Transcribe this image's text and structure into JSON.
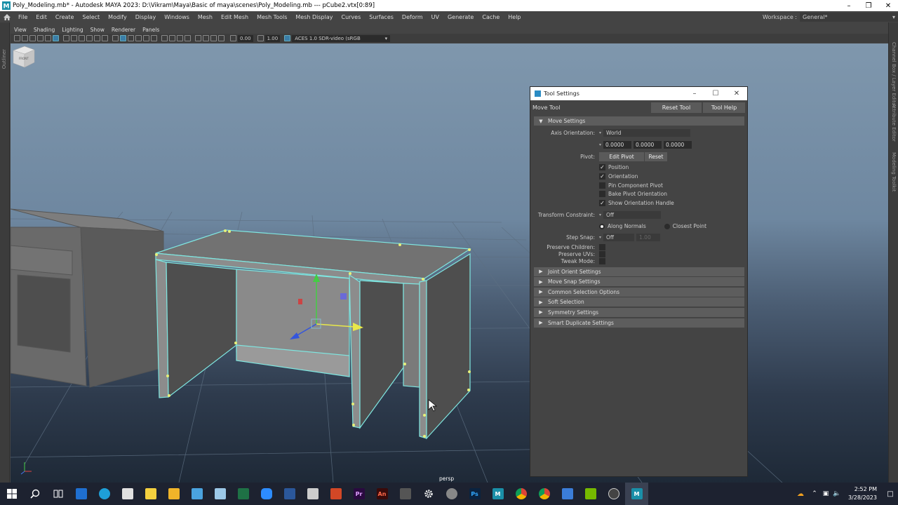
{
  "window": {
    "title": "Poly_Modeling.mb* - Autodesk MAYA 2023: D:\\Vikram\\Maya\\Basic of maya\\scenes\\Poly_Modeling.mb   ---   pCube2.vtx[0:89]",
    "controls": [
      "minimize-icon",
      "restore-icon",
      "close-icon"
    ]
  },
  "menu": {
    "items": [
      "File",
      "Edit",
      "Create",
      "Select",
      "Modify",
      "Display",
      "Windows",
      "Mesh",
      "Edit Mesh",
      "Mesh Tools",
      "Mesh Display",
      "Curves",
      "Surfaces",
      "Deform",
      "UV",
      "Generate",
      "Cache",
      "Help"
    ],
    "workspace_label": "Workspace :",
    "workspace_value": "General*"
  },
  "side_tabs": {
    "left": "Outliner",
    "right": [
      "Channel Box / Layer Editor",
      "Attribute Editor",
      "Modeling Toolkit"
    ]
  },
  "panel": {
    "menu": [
      "View",
      "Shading",
      "Lighting",
      "Show",
      "Renderer",
      "Panels"
    ],
    "toolbar": {
      "field1": "0.00",
      "field2": "1.00",
      "color_space": "ACES 1.0 SDR-video (sRGB"
    },
    "camera_label": "persp",
    "viewcube_label": "FRONT"
  },
  "tool_settings": {
    "window_title": "Tool Settings",
    "tool_name": "Move Tool",
    "reset_tool": "Reset Tool",
    "tool_help": "Tool Help",
    "move_settings": {
      "header": "Move Settings",
      "axis_orientation_label": "Axis Orientation:",
      "axis_orientation_value": "World",
      "xyz": [
        "0.0000",
        "0.0000",
        "0.0000"
      ],
      "pivot_label": "Pivot:",
      "edit_pivot": "Edit Pivot",
      "reset": "Reset",
      "checkboxes": [
        {
          "label": "Position",
          "checked": true
        },
        {
          "label": "Orientation",
          "checked": true
        },
        {
          "label": "Pin Component Pivot",
          "checked": false
        },
        {
          "label": "Bake Pivot Orientation",
          "checked": false
        },
        {
          "label": "Show Orientation Handle",
          "checked": true
        }
      ],
      "transform_constraint_label": "Transform Constraint:",
      "transform_constraint_value": "Off",
      "along_normals": "Along Normals",
      "closest_point": "Closest Point",
      "step_snap_label": "Step Snap:",
      "step_snap_value": "Off",
      "step_snap_amount": "1.00",
      "preserve_children": "Preserve Children:",
      "preserve_uvs": "Preserve UVs:",
      "tweak_mode": "Tweak Mode:"
    },
    "collapsed_sections": [
      "Joint Orient Settings",
      "Move Snap Settings",
      "Common Selection Options",
      "Soft Selection",
      "Symmetry Settings",
      "Smart Duplicate Settings"
    ]
  },
  "taskbar": {
    "time": "2:52 PM",
    "date": "3/28/2023",
    "apps": [
      "start-icon",
      "search-icon",
      "task-view-icon",
      "mail-icon",
      "edge-icon",
      "store-icon",
      "sticky-notes-icon",
      "file-explorer-icon",
      "paint-icon",
      "notepad-icon",
      "excel-icon",
      "zoom-icon",
      "word-icon",
      "chess-icon",
      "powerpoint-icon",
      "premiere-icon",
      "animate-icon",
      "inkscape-icon",
      "settings-icon",
      "vlc-icon",
      "photoshop-icon",
      "maya-m-icon",
      "chrome-icon",
      "chrome-2-icon",
      "remote-desktop-icon",
      "nvidia-icon",
      "clock-app-icon",
      "maya-icon"
    ],
    "ps_letters": "Ps",
    "pr_letters": "Pr",
    "an_letters": "An"
  }
}
